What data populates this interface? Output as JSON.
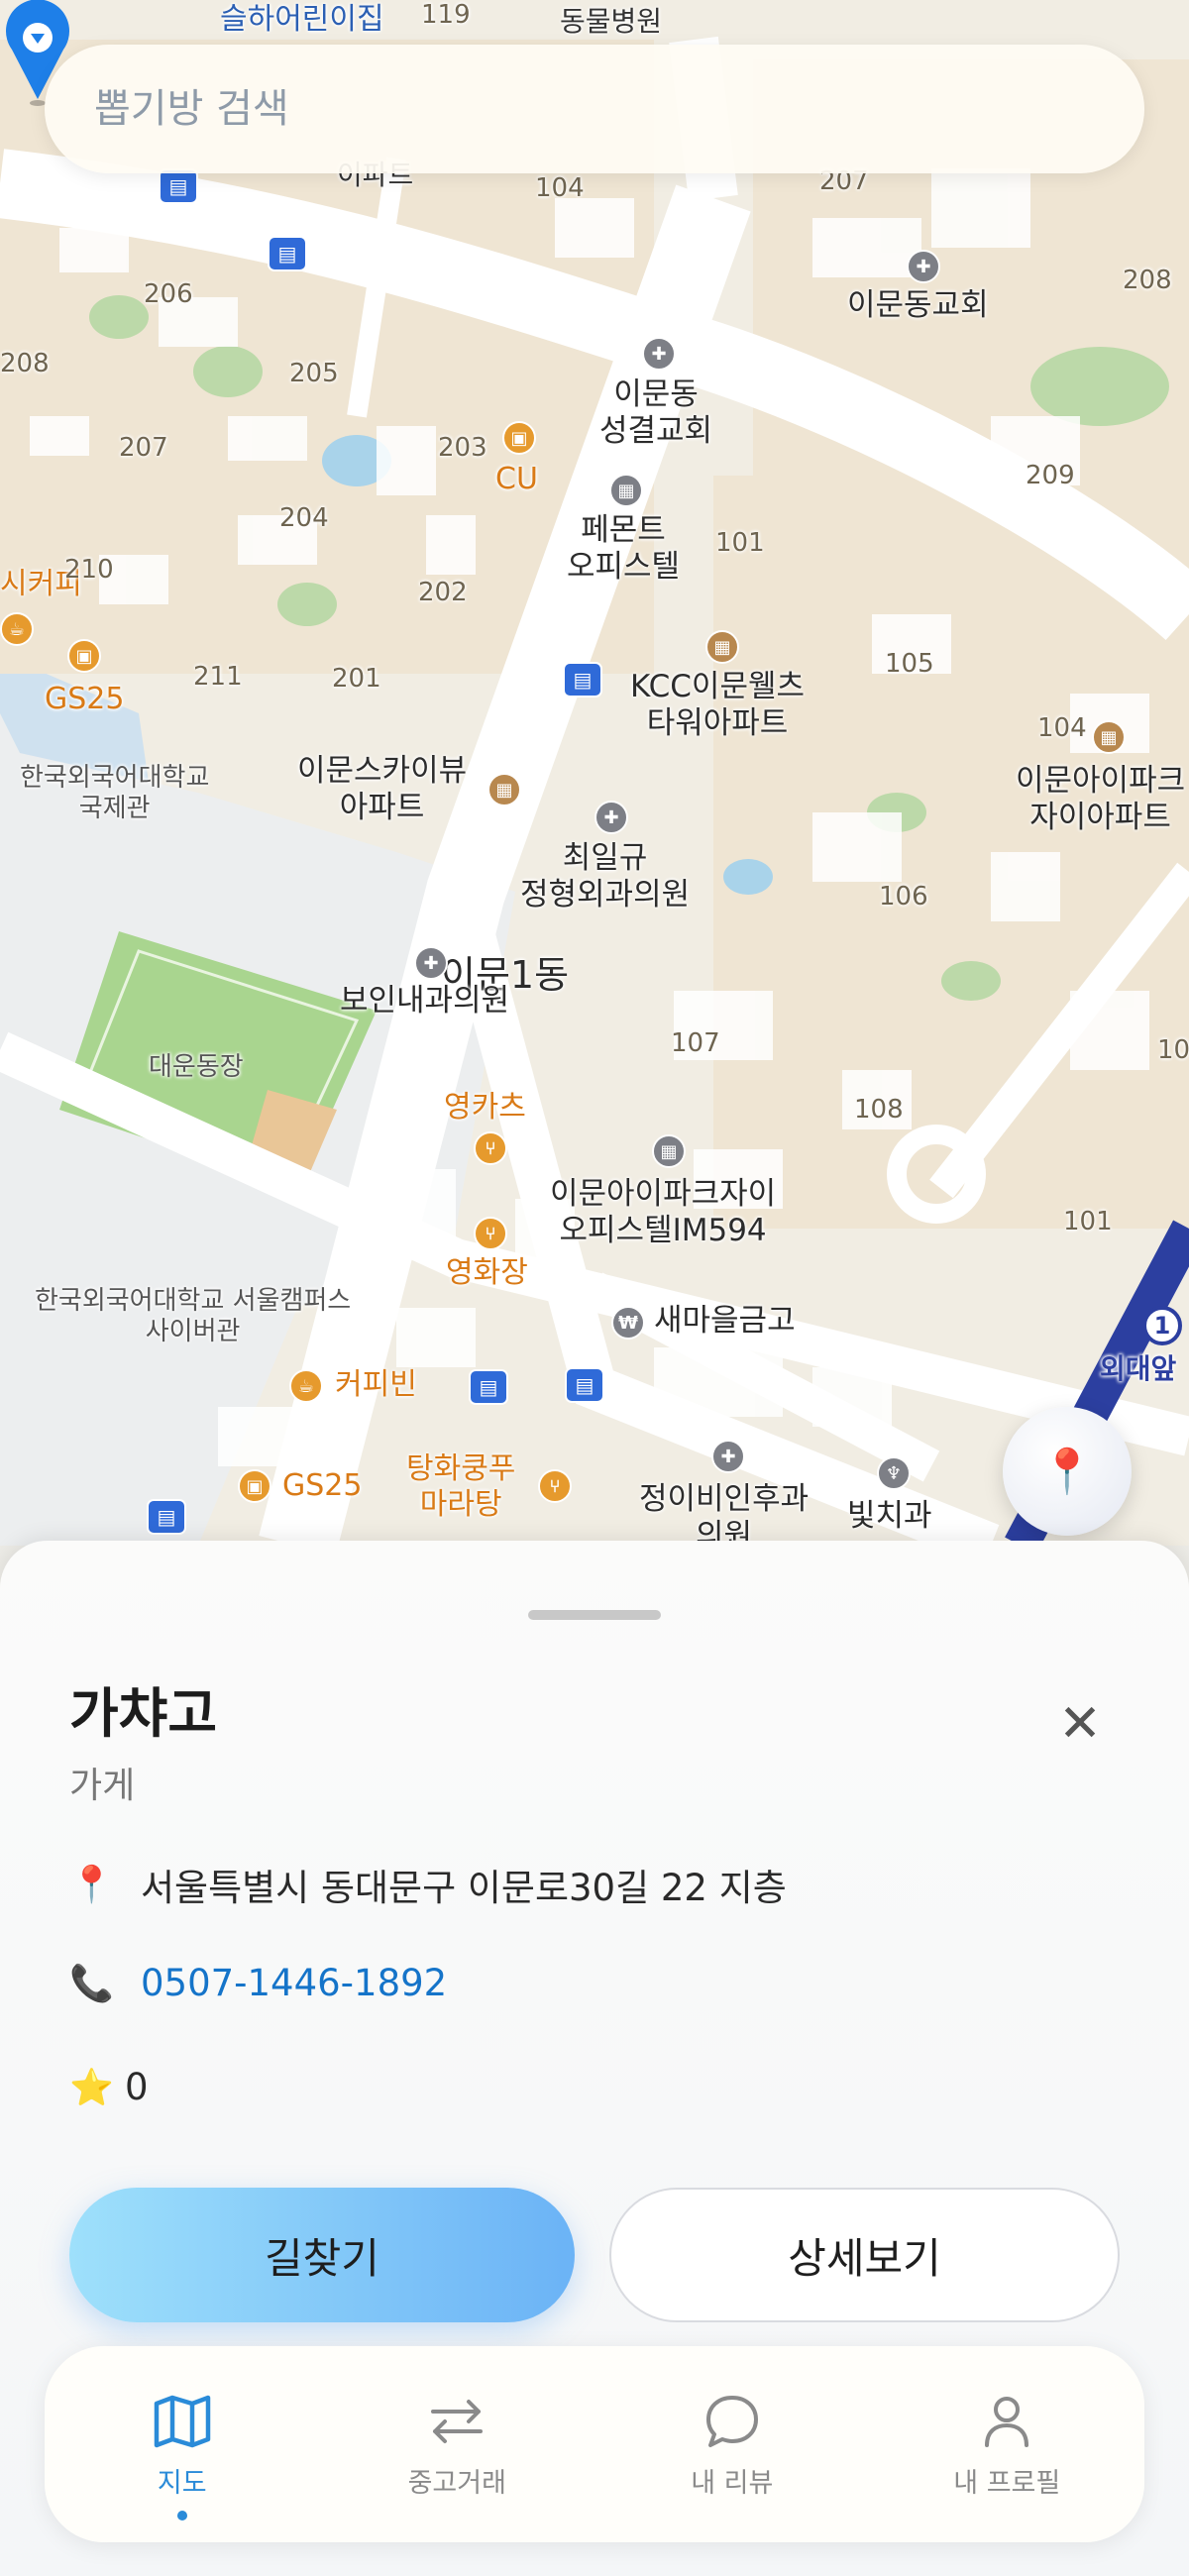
{
  "search": {
    "placeholder": "뽑기방 검색"
  },
  "map": {
    "labels": {
      "kindergarten": "슬하어린이집",
      "animal_hospital": "동물병원",
      "apt_hint": "이파트",
      "church_imun": "이문동교회",
      "church_seonggyeol": "이문동\n성결교회",
      "cu": "CU",
      "pemont": "페몬트\n오피스텔",
      "kcc": "KCC이문웰츠\n타워아파트",
      "iaipark": "이문아이파크\n자이아파트",
      "hufs_intl": "한국외국어대학교\n국제관",
      "skyview": "이문스카이뷰\n아파트",
      "choi_ortho": "최일규\n정형외과의원",
      "imun1dong": "이문1동",
      "boin_clinic": "보인내과의원",
      "daeun_field": "대운동장",
      "youngkatz": "영카츠",
      "iaipark_officetel": "이문아이파크자이\n오피스텔IM594",
      "younghwajang": "영화장",
      "saemaeul": "새마을금고",
      "hufs_cyber": "한국외국어대학교 서울캠퍼스\n사이버관",
      "coffeebean": "커피빈",
      "gs25_a": "GS25",
      "gs25_b": "GS25",
      "coffee_partial": "시커피",
      "tanghulu": "탕화쿵푸\n마라탕",
      "jeongibi": "정이비인후과\n의원",
      "dental": "빛치과",
      "hufs_station": "외대앞",
      "station_num": "1"
    },
    "building_numbers": [
      "119",
      "104",
      "207",
      "208",
      "206",
      "205",
      "208",
      "207",
      "203",
      "209",
      "204",
      "210",
      "202",
      "101",
      "211",
      "201",
      "105",
      "104",
      "106",
      "107",
      "108",
      "101",
      "10"
    ]
  },
  "place": {
    "name": "가챠고",
    "category": "가게",
    "address": "서울특별시 동대문구 이문로30길 22 지층",
    "phone": "0507-1446-1892",
    "rating": "0"
  },
  "actions": {
    "directions": "길찾기",
    "details": "상세보기"
  },
  "nav": [
    {
      "label": "지도",
      "icon": "map-icon",
      "active": true
    },
    {
      "label": "중고거래",
      "icon": "swap-arrows-icon",
      "active": false
    },
    {
      "label": "내 리뷰",
      "icon": "chat-bubble-icon",
      "active": false
    },
    {
      "label": "내 프로필",
      "icon": "user-icon",
      "active": false
    }
  ],
  "colors": {
    "accent": "#2a8bd8",
    "phone": "#1574c9",
    "button_gradient_start": "#9ee0fb",
    "button_gradient_end": "#6bb3f6",
    "marker": "#1e7fe8"
  }
}
